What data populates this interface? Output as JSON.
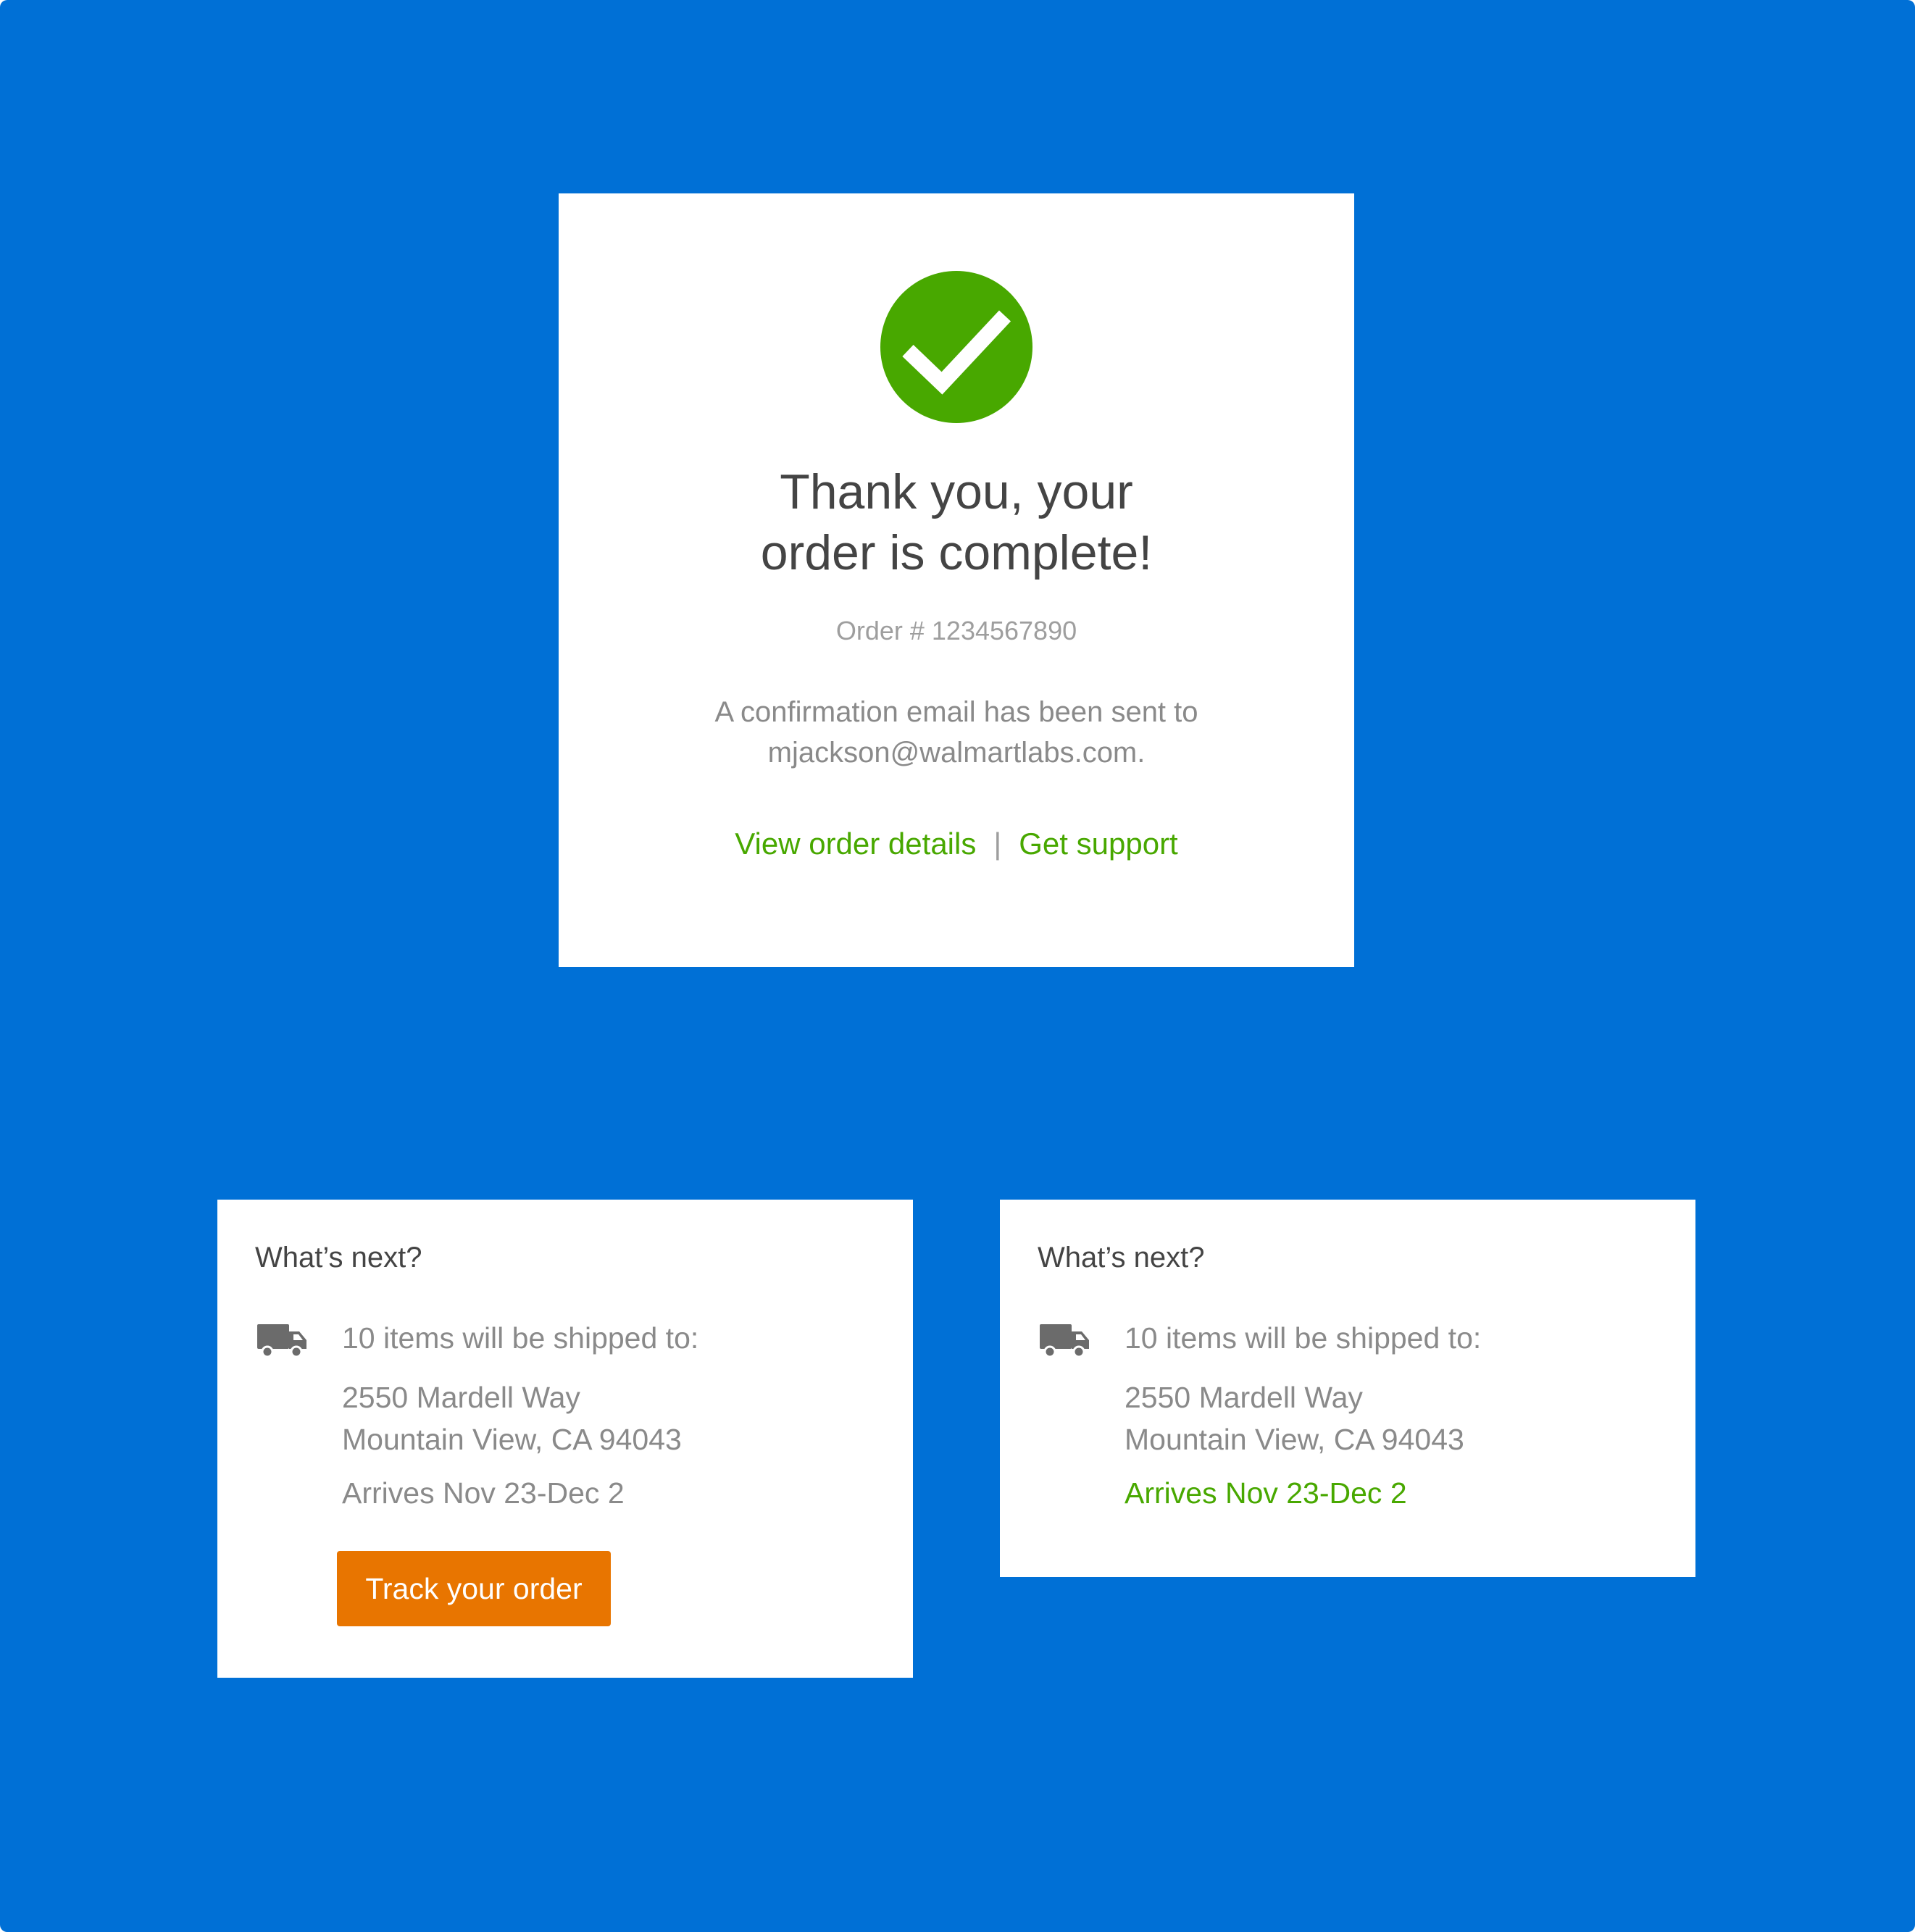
{
  "colors": {
    "background": "#0070D6",
    "success": "#48A800",
    "button": "#E87500"
  },
  "confirmation": {
    "icon": "checkmark-icon",
    "title_line1": "Thank you, your",
    "title_line2": "order is complete!",
    "order_number": "Order # 1234567890",
    "email_line1": "A confirmation email has been sent to",
    "email_line2": "mjackson@walmartlabs.com.",
    "link_view": "View order details",
    "link_separator": "|",
    "link_support": "Get support"
  },
  "next_cards": [
    {
      "title": "What’s next?",
      "icon": "truck-icon",
      "shipping": "10 items will be shipped to:",
      "address_line1": "2550 Mardell Way",
      "address_line2": "Mountain View, CA 94043",
      "arrives": "Arrives Nov 23-Dec 2",
      "button": "Track your order"
    },
    {
      "title": "What’s next?",
      "icon": "truck-icon",
      "shipping": "10 items will be shipped to:",
      "address_line1": "2550 Mardell Way",
      "address_line2": "Mountain View, CA 94043",
      "arrives": "Arrives Nov 23-Dec 2"
    }
  ]
}
